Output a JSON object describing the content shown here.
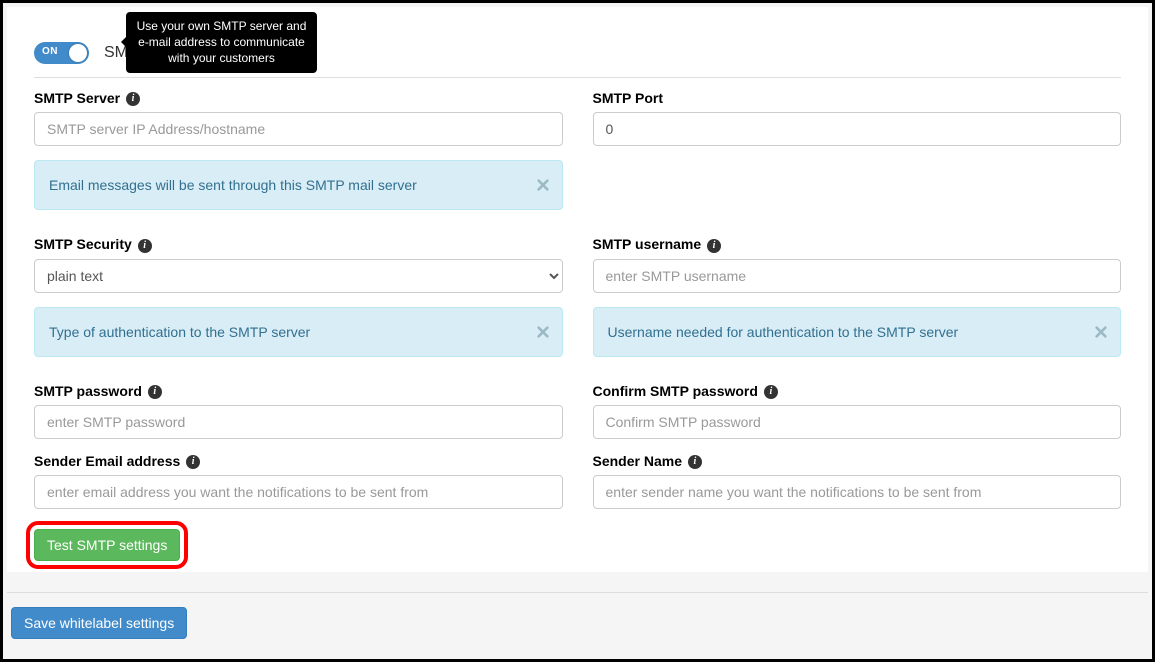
{
  "header": {
    "toggle_label": "ON",
    "section_title": "SMTP settings",
    "tooltip": "Use your own SMTP server and e-mail address to communicate with your customers"
  },
  "fields": {
    "smtp_server": {
      "label": "SMTP Server",
      "placeholder": "SMTP server IP Address/hostname"
    },
    "smtp_port": {
      "label": "SMTP Port",
      "value": "0"
    },
    "smtp_security": {
      "label": "SMTP Security",
      "value": "plain text",
      "options": [
        "plain text"
      ]
    },
    "smtp_username": {
      "label": "SMTP username",
      "placeholder": "enter SMTP username"
    },
    "smtp_password": {
      "label": "SMTP password",
      "placeholder": "enter SMTP password"
    },
    "confirm_password": {
      "label": "Confirm SMTP password",
      "placeholder": "Confirm SMTP password"
    },
    "sender_email": {
      "label": "Sender Email address",
      "placeholder": "enter email address you want the notifications to be sent from"
    },
    "sender_name": {
      "label": "Sender Name",
      "placeholder": "enter sender name you want the notifications to be sent from"
    }
  },
  "alerts": {
    "server": "Email messages will be sent through this SMTP mail server",
    "security": "Type of authentication to the SMTP server",
    "username": "Username needed for authentication to the SMTP server"
  },
  "buttons": {
    "test": "Test SMTP settings",
    "save": "Save whitelabel settings"
  },
  "icons": {
    "info_glyph": "i"
  }
}
